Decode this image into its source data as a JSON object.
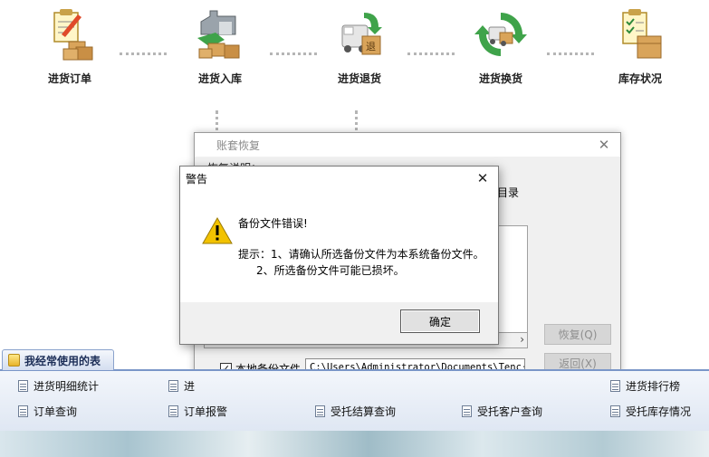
{
  "workflow": {
    "items": [
      {
        "label": "进货订单",
        "icon": "purchase-order-icon"
      },
      {
        "label": "进货入库",
        "icon": "stock-in-icon"
      },
      {
        "label": "进货退货",
        "icon": "purchase-return-icon"
      },
      {
        "label": "进货换货",
        "icon": "purchase-exchange-icon"
      },
      {
        "label": "库存状况",
        "icon": "inventory-status-icon"
      }
    ]
  },
  "frequent": {
    "title": "我经常使用的表",
    "links": [
      "进货明细统计",
      "进",
      "进货排行榜",
      "订单查询",
      "订单报警",
      "受托结算查询",
      "受托客户查询",
      "受托库存情况"
    ]
  },
  "restore_dialog": {
    "title": "账套恢复",
    "description": "恢复说明：",
    "directory_text": "目录",
    "restore_button": "恢复(Q)",
    "back_button": "返回(X)",
    "local_backup_label": "本地备份文件",
    "local_backup_checked": true,
    "backup_path": "C:\\Users\\Administrator\\Documents\\Tenc···"
  },
  "alert_dialog": {
    "title": "警告",
    "message": "备份文件错误!",
    "hint_line1": "提示：1、请确认所选备份文件为本系统备份文件。",
    "hint_line2": "2、所选备份文件可能已损坏。",
    "ok_button": "确定"
  },
  "colors": {
    "accent": "#7a96c8",
    "warning": "#f2c200",
    "dialog_bg": "#f0f0f0"
  }
}
